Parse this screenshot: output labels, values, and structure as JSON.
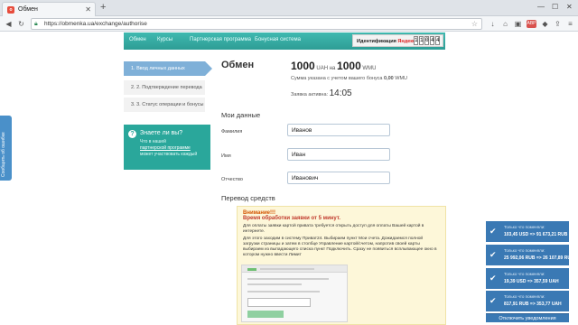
{
  "browser": {
    "tab_title": "Обмен",
    "url": "https://obmenka.ua/exchange/authorise"
  },
  "site_nav": {
    "items": [
      "Обмен",
      "Курсы",
      "Партнерская программа",
      "Бонусная система"
    ],
    "identification_label": "Идентификация",
    "identification_brand": "Яндекс",
    "counter_digits": [
      "1",
      "1",
      "0",
      "4",
      "4"
    ]
  },
  "steps": [
    {
      "label": "1. Ввод личных данных",
      "active": true
    },
    {
      "label": "2. 2. Подтверждение перевода",
      "active": false
    },
    {
      "label": "3. 3. Статус операции и бонусы",
      "active": false
    }
  ],
  "help": {
    "title": "Знаете ли вы?",
    "text_before": "Что в нашей",
    "link": "партнерской программе",
    "text_after": "может участвовать каждый"
  },
  "exchange": {
    "title": "Обмен",
    "give_amount": "1000",
    "give_currency": "UAH",
    "connector": "на",
    "get_amount": "1000",
    "get_currency": "WMU",
    "bonus_note_prefix": "Сумма указана с учетом вашего бонуса",
    "bonus_value": "0,00",
    "bonus_currency": "WMU",
    "active_label": "Заявка активна:",
    "active_time": "14:05"
  },
  "personal": {
    "section_title": "Мои данные",
    "fields": [
      {
        "label": "Фамилия",
        "value": "Иванов"
      },
      {
        "label": "Имя",
        "value": "Иван"
      },
      {
        "label": "Отчество",
        "value": "Иванович"
      }
    ]
  },
  "transfer": {
    "section_title": "Перевод средств",
    "warn_title": "Внимание!!!",
    "warn_time": "Время обработки заявки от 5 минут.",
    "p1": "Для оплаты заявки картой привата требуется открыть доступ для оплаты Вашей картой в интернете.",
    "p2": "Для этого заходим в систему Приват24. Выбираем пункт Мои счета. Дожидаемся полной загрузки страницы и затем в столбце Управление картой/счетом, напротив своей карты выбираем из выпадающего списка пункт Подключить. Сразу не появиться всплывающее окно в котором нужно ввести Лимит"
  },
  "side_tab": {
    "label": "Сообщить об ошибке"
  },
  "notifications": [
    {
      "caption": "Только что поменяли:",
      "text": "103,45 USD => 91 673,21 RUB"
    },
    {
      "caption": "Только что поменяли:",
      "text": "25 992,06 RUB => 26 107,89 RUB"
    },
    {
      "caption": "Только что поменяли:",
      "text": "19,39 USD => 357,59 UAH"
    },
    {
      "caption": "Только что поменяли:",
      "text": "817,91 RUB => 353,77 UAH"
    }
  ],
  "notif_button": "Отключить уведомления"
}
